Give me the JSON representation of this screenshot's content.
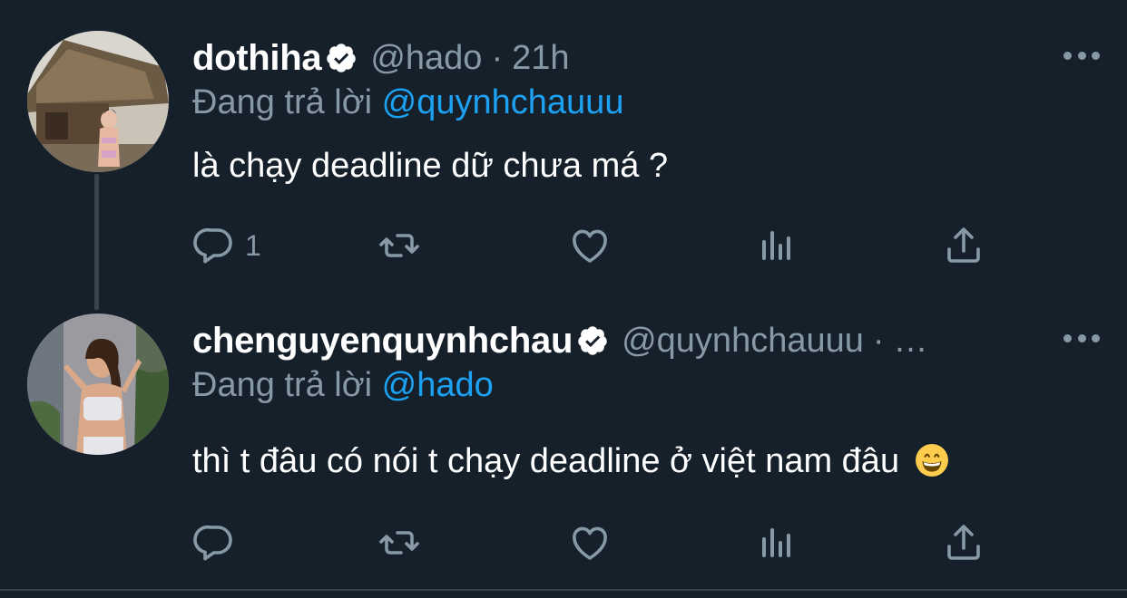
{
  "tweets": [
    {
      "display_name": "dothiha",
      "verified": true,
      "handle": "@hado",
      "separator": "·",
      "time": "21h",
      "replying_prefix": "Đang trả lời",
      "replying_to": "@quynhchauuu",
      "text": "là chạy deadline dữ chưa má ?",
      "reply_count": "1",
      "avatar_icon": "avatar-photo-icon"
    },
    {
      "display_name": "chenguyenquynhchau",
      "verified": true,
      "handle": "@quynhchauuu",
      "separator": "·",
      "time": "…",
      "replying_prefix": "Đang trả lời",
      "replying_to": "@hado",
      "text": "thì t đâu có nói t chạy deadline ở việt nam đâu",
      "emoji": "grinning-face-icon",
      "reply_count": "",
      "avatar_icon": "avatar-photo-icon"
    }
  ],
  "colors": {
    "background": "#15202b",
    "secondary_text": "#8899a6",
    "accent": "#1da1f2",
    "divider": "#38444d"
  }
}
